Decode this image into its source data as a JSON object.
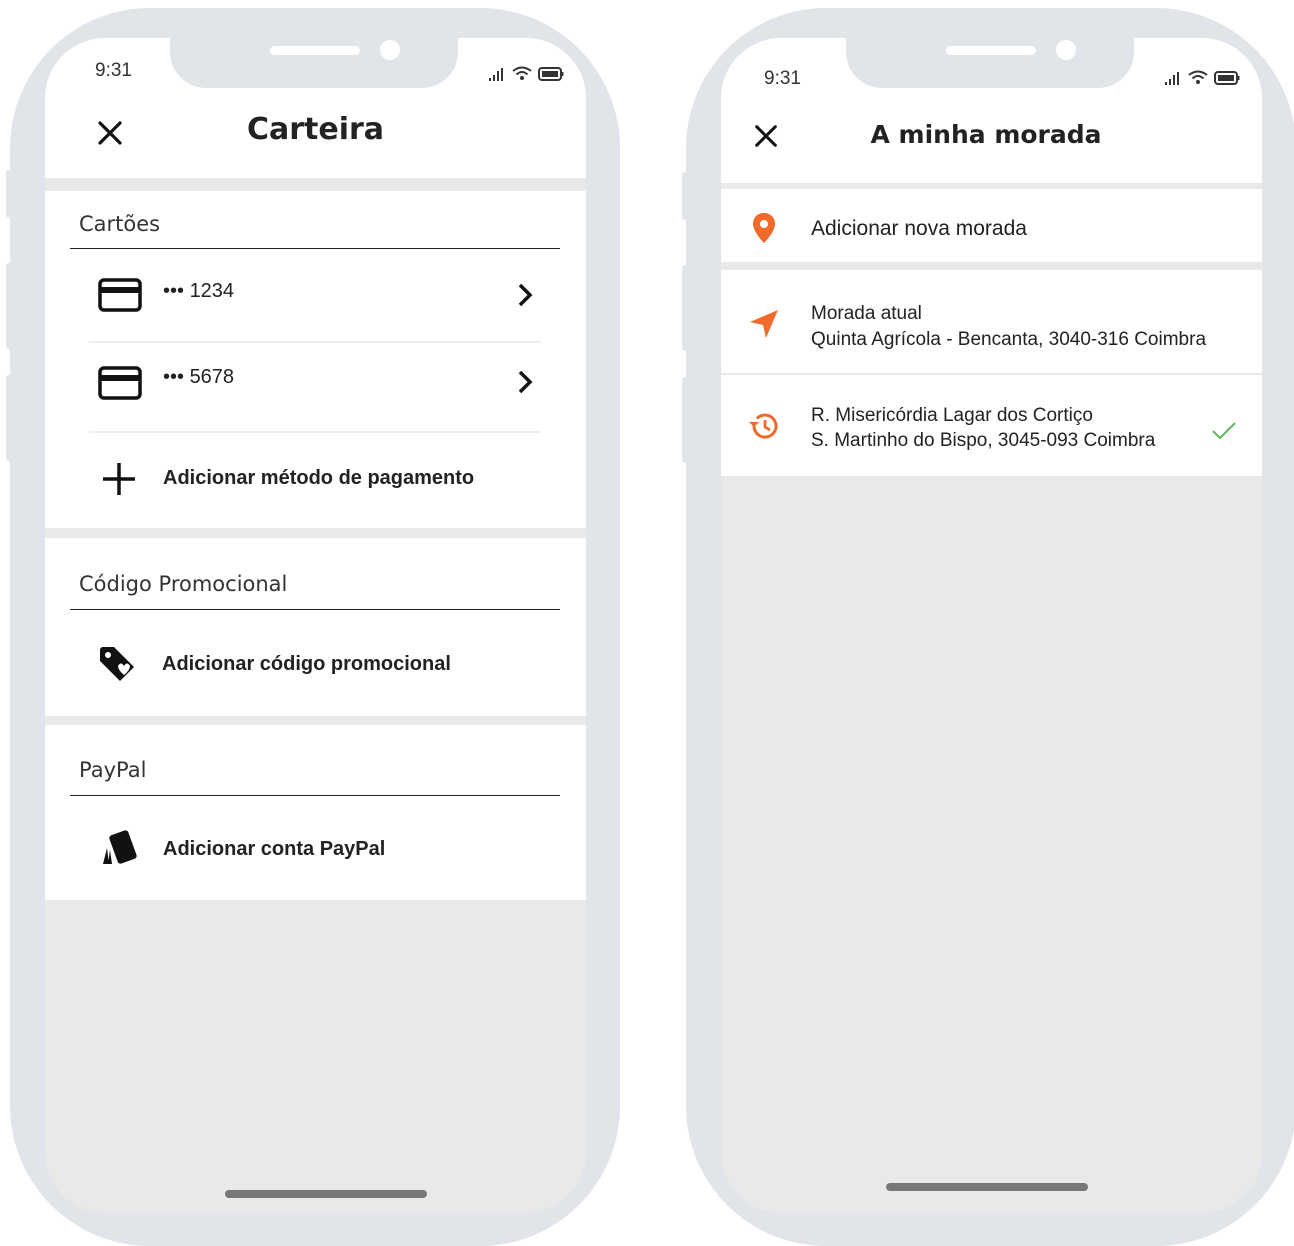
{
  "wallet": {
    "time": "9:31",
    "title": "Carteira",
    "cards_label": "Cartões",
    "cards": [
      {
        "number": "••• 1234"
      },
      {
        "number": "••• 5678"
      }
    ],
    "add_payment_label": "Adicionar método de pagamento",
    "promo_label": "Código Promocional",
    "add_promo_label": "Adicionar código promocional",
    "paypal_label": "PayPal",
    "add_paypal_label": "Adicionar conta PayPal"
  },
  "address": {
    "time": "9:31",
    "title": "A minha morada",
    "add_address_label": "Adicionar nova morada",
    "current": {
      "label": "Morada atual",
      "value": "Quinta Agrícola - Bencanta, 3040-316 Coimbra"
    },
    "recent": {
      "line1": "R. Misericórdia Lagar dos Cortiço",
      "line2": "S. Martinho do Bispo, 3045-093 Coimbra"
    }
  },
  "colors": {
    "accent": "#f26a2a",
    "check": "#5cb85c",
    "frame": "#e1e4e8",
    "screen_bg": "#e9e9e9"
  }
}
